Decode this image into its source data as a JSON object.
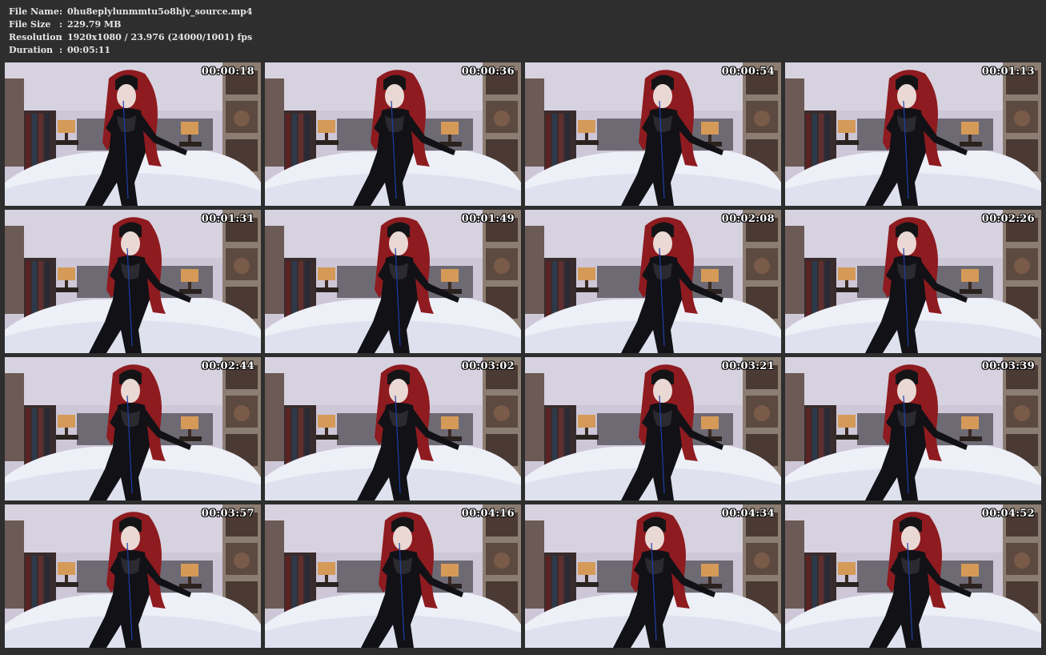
{
  "info": [
    {
      "key": "File Name",
      "sep": ":",
      "value": "0hu8eplylunmmtu5o8hjv_source.mp4"
    },
    {
      "key": "File Size",
      "sep": ":",
      "value": "229.79 MB"
    },
    {
      "key": "Resolution",
      "sep": ":",
      "value": "1920x1080 / 23.976 (24000/1001) fps"
    },
    {
      "key": "Duration",
      "sep": ":",
      "value": "00:05:11"
    }
  ],
  "thumbnails": [
    {
      "time": "00:00:18"
    },
    {
      "time": "00:00:36"
    },
    {
      "time": "00:00:54"
    },
    {
      "time": "00:01:13"
    },
    {
      "time": "00:01:31"
    },
    {
      "time": "00:01:49"
    },
    {
      "time": "00:02:08"
    },
    {
      "time": "00:02:26"
    },
    {
      "time": "00:02:44"
    },
    {
      "time": "00:03:02"
    },
    {
      "time": "00:03:21"
    },
    {
      "time": "00:03:39"
    },
    {
      "time": "00:03:57"
    },
    {
      "time": "00:04:16"
    },
    {
      "time": "00:04:34"
    },
    {
      "time": "00:04:52"
    }
  ],
  "colors": {
    "background": "#2e2e2e",
    "text": "#e6e6e6",
    "wall": "#c9c3d3",
    "bed": "#eef0f8",
    "hair": "#8e1b1f",
    "latex": "#111116"
  }
}
